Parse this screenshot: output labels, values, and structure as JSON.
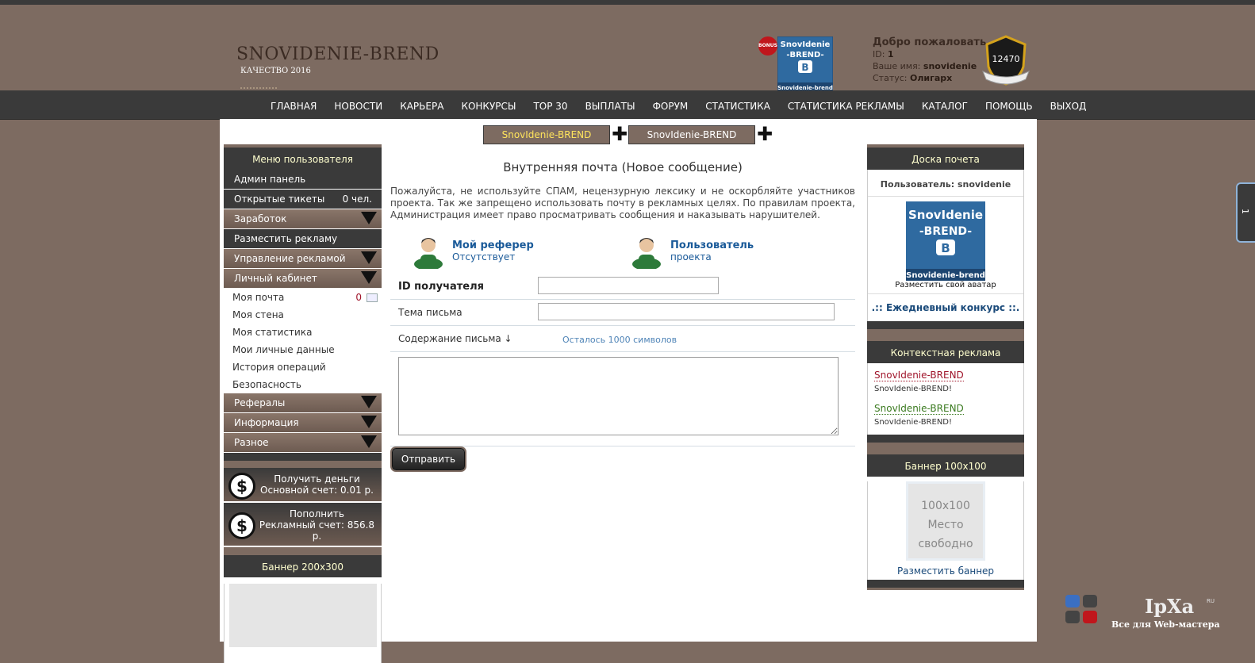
{
  "header": {
    "logo_title": "SNOVIDENIE-BREND",
    "logo_sub": "КАЧЕСТВО 2016",
    "bonus_label": "BONUS",
    "vk_badge_line1": "SnovIdenie",
    "vk_badge_line2": "-BREND-",
    "vk_badge_line3": "Snovidenie-brend",
    "welcome_title": "Добро пожаловать",
    "id_label": "ID:",
    "id_value": "1",
    "name_label": "Ваше имя:",
    "name_value": "snovidenie",
    "status_label": "Статус:",
    "status_value": "Олигарх",
    "score": "12470"
  },
  "nav": [
    "ГЛАВНАЯ",
    "НОВОСТИ",
    "КАРЬЕРА",
    "КОНКУРСЫ",
    "TOP 30",
    "ВЫПЛАТЫ",
    "ФОРУМ",
    "СТАТИСТИКА",
    "СТАТИСТИКА РЕКЛАМЫ",
    "КАТАЛОГ",
    "ПОМОЩЬ",
    "ВЫХОД"
  ],
  "ad_tabs": [
    "SnovIdenie-BREND",
    "SnovIdenie-BREND"
  ],
  "left": {
    "menu_title": "Меню пользователя",
    "admin": "Админ панель",
    "tickets": "Открытые тикеты",
    "tickets_count": "0 чел.",
    "earnings": "Заработок",
    "place_ad": "Разместить рекламу",
    "manage_ads": "Управление рекламой",
    "cabinet": "Личный кабинет",
    "sub": {
      "mail": "Моя почта",
      "mail_count": "0",
      "wall": "Моя стена",
      "stats": "Моя статистика",
      "personal": "Мои личные данные",
      "history": "История операций",
      "security": "Безопасность"
    },
    "referrals": "Рефералы",
    "info": "Информация",
    "misc": "Разное",
    "get_money": "Получить деньги",
    "main_account": "Основной счет: 0.01 р.",
    "topup": "Пополнить",
    "ad_account": "Рекламный счет: 856.8 р.",
    "banner_title": "Баннер 200x300"
  },
  "center": {
    "title": "Внутренняя почта (Новое сообщение)",
    "warning": "Пожалуйста, не используйте СПАМ, нецензурную лексику и не оскорбляйте участников проекта. Так же запрещено использовать почту в рекламных целях. По правилам проекта, Администрация имеет право просматривать сообщения и наказывать нарушителей.",
    "ref1_title": "Мой реферер",
    "ref1_sub": "Отсутствует",
    "ref2_title": "Пользователь",
    "ref2_sub": "проекта",
    "recipient_label": "ID получателя",
    "recipient_value": "",
    "subject_label": "Тема письма",
    "subject_value": "",
    "content_label": "Содержание письма ↓",
    "remaining": "Осталось 1000 символов",
    "message_value": "",
    "send": "Отправить"
  },
  "right": {
    "honor_title": "Доска почета",
    "user_line": "Пользователь: snovidenie",
    "avatar_link": "Разместить свой аватар",
    "daily": ".:: Ежедневный конкурс ::.",
    "ctx_title": "Контекстная реклама",
    "ctx": [
      {
        "link": "SnovIdenie-BREND",
        "desc": "SnovIdenie-BREND!"
      },
      {
        "link": "SnovIdenie-BREND",
        "desc": "SnovIdenie-BREND!"
      }
    ],
    "banner100_title": "Баннер 100x100",
    "banner100_l1": "100x100",
    "banner100_l2": "Место",
    "banner100_l3": "свободно",
    "banner100_link": "Разместить баннер"
  },
  "side_tab": "1",
  "watermark": {
    "name": "IpXa",
    "ru": "RU",
    "tagline": "Все для Web-мастера"
  },
  "colors": {
    "page_bg": "#7d6b61",
    "dark_bar": "#3a3a3a",
    "link_blue": "#1a5a99",
    "accent_red": "#a0152b",
    "accent_green": "#3a7a1f"
  }
}
